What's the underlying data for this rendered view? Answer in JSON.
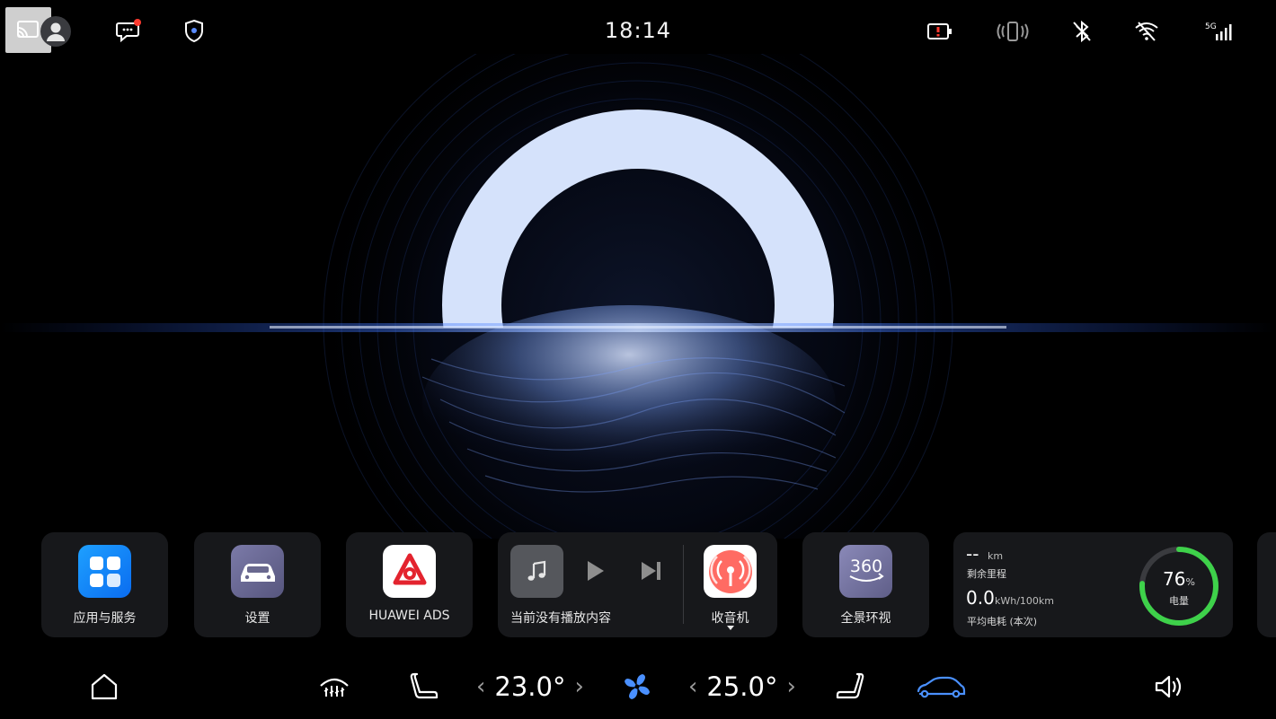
{
  "status_bar": {
    "time": "18:14",
    "network_label": "5G",
    "icons": [
      "screen-cast-icon",
      "user-avatar-icon",
      "message-icon",
      "shield-icon",
      "battery-alert-icon",
      "vibrate-icon",
      "bluetooth-off-icon",
      "wifi-off-icon",
      "signal-5g-icon"
    ],
    "notification_dot_color": "#ff3b30"
  },
  "cards": {
    "apps": {
      "label": "应用与服务"
    },
    "settings": {
      "label": "设置"
    },
    "ads": {
      "label": "HUAWEI ADS"
    },
    "media": {
      "label": "当前没有播放内容"
    },
    "radio": {
      "label": "收音机"
    },
    "surround": {
      "label": "全景环视",
      "icon_text": "360"
    },
    "energy": {
      "range_value": "--",
      "range_unit": "km",
      "range_label": "剩余里程",
      "consumption_value": "0.0",
      "consumption_unit": "kWh/100km",
      "consumption_label": "平均电耗 (本次)",
      "battery_value": "76",
      "battery_unit": "%",
      "battery_label": "电量",
      "battery_fraction": 0.76,
      "gauge_color": "#3ed14a"
    }
  },
  "dock": {
    "driver_temp": "23.0°",
    "passenger_temp": "25.0°",
    "accent_color": "#4a90ff"
  }
}
